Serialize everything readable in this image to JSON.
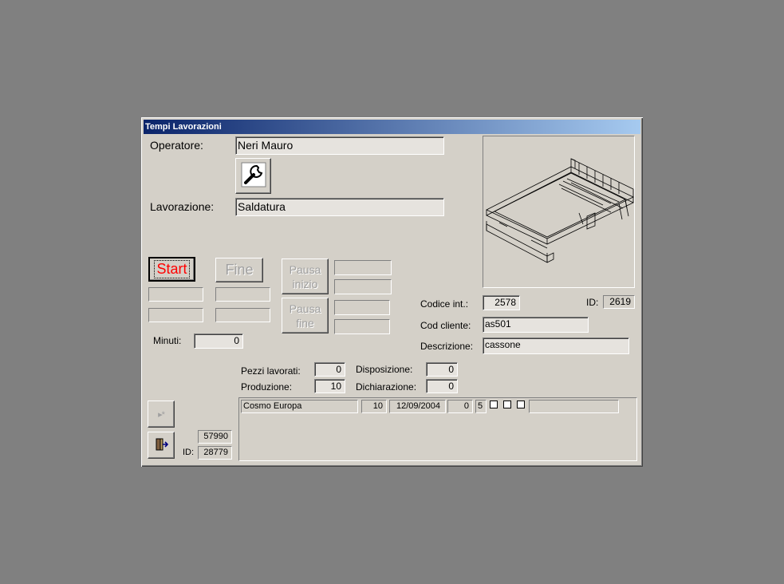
{
  "window": {
    "title": "Tempi Lavorazioni"
  },
  "operatore": {
    "label": "Operatore:",
    "value": "Neri Mauro"
  },
  "lavorazione": {
    "label": "Lavorazione:",
    "value": "Saldatura"
  },
  "buttons": {
    "start": "Start",
    "fine": "Fine",
    "pausa_inizio": "Pausa inizio",
    "pausa_fine": "Pausa fine"
  },
  "minuti": {
    "label": "Minuti:",
    "value": "0"
  },
  "codice": {
    "label": "Codice  int.:",
    "value": "2578"
  },
  "id_top": {
    "label": "ID:",
    "value": "2619"
  },
  "cod_cliente": {
    "label": "Cod cliente:",
    "value": "as501"
  },
  "descrizione": {
    "label": "Descrizione:",
    "value": "cassone"
  },
  "pezzi": {
    "label": "Pezzi lavorati:",
    "value": "0"
  },
  "produzione": {
    "label": "Produzione:",
    "value": "10"
  },
  "disposizione": {
    "label": "Disposizione:",
    "value": "0"
  },
  "dichiarazione": {
    "label": "Dichiarazione:",
    "value": "0"
  },
  "record": {
    "value": "57990"
  },
  "id_bottom": {
    "label": "ID:",
    "value": "28779"
  },
  "order_row": {
    "cliente": "Cosmo Europa",
    "qty": "10",
    "date": "12/09/2004",
    "val1": "0",
    "val2": "5"
  },
  "icons": {
    "tool": "wrench-icon",
    "new_record": "new-record-icon",
    "exit": "exit-door-icon"
  }
}
